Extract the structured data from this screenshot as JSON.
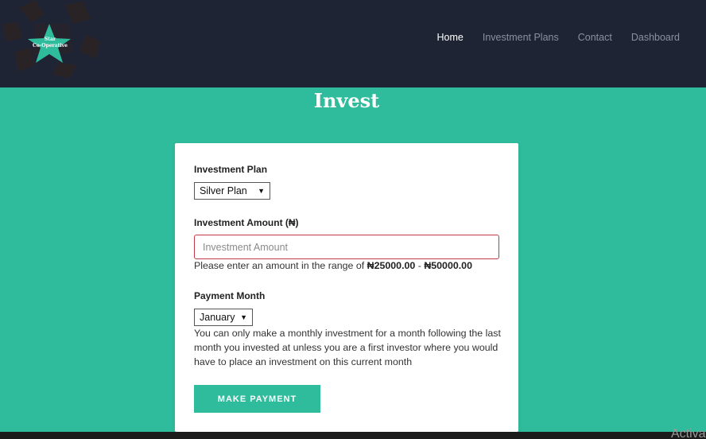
{
  "brand": {
    "line1": "Star",
    "line2": "Co-Operative"
  },
  "nav": {
    "items": [
      {
        "label": "Home",
        "active": true
      },
      {
        "label": "Investment Plans",
        "active": false
      },
      {
        "label": "Contact",
        "active": false
      },
      {
        "label": "Dashboard",
        "active": false
      }
    ]
  },
  "page": {
    "title": "Invest"
  },
  "form": {
    "plan_label": "Investment Plan",
    "plan_selected": "Silver Plan",
    "amount_label": "Investment Amount (₦)",
    "amount_placeholder": "Investment Amount",
    "amount_help_prefix": "Please enter an amount in the range of ",
    "amount_min": "₦25000.00",
    "amount_sep": " - ",
    "amount_max": "₦50000.00",
    "month_label": "Payment Month",
    "month_selected": "January",
    "month_help": "You can only make a monthly investment for a month following the last month you invested at unless you are a first investor where you would have to place an investment on this current month",
    "submit_label": "MAKE PAYMENT"
  },
  "watermark": "Activat",
  "colors": {
    "nav_bg": "#1f2434",
    "accent": "#2fbc9c",
    "error_border": "#c13a46"
  }
}
